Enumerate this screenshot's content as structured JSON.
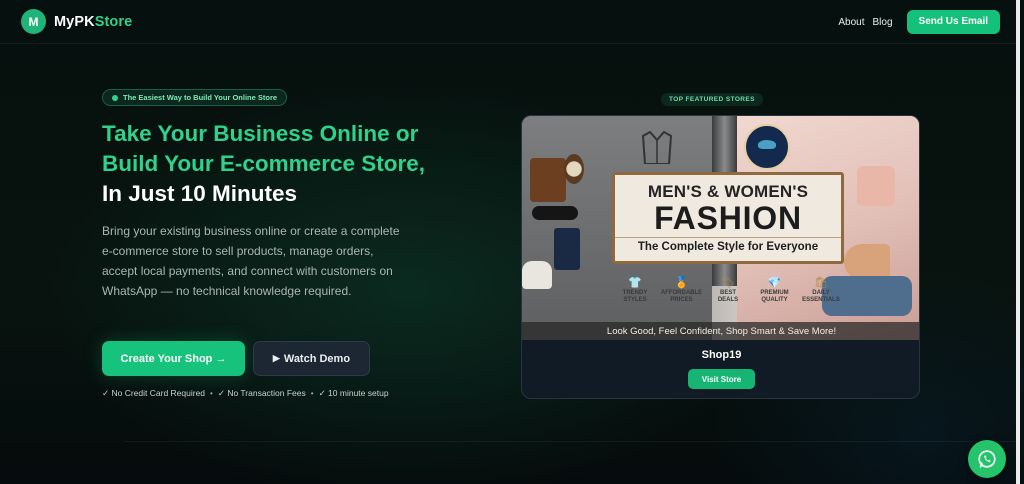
{
  "header": {
    "logo_letter": "M",
    "logo_text_a": "MyPK",
    "logo_text_b": "Store",
    "nav": [
      {
        "label": "About"
      },
      {
        "label": "Blog"
      }
    ],
    "cta_label": "Send Us Email"
  },
  "hero": {
    "pill": "The Easiest Way to Build Your Online Store",
    "headline_green_1": "Take Your Business Online or",
    "headline_green_2": "Build Your E-commerce Store,",
    "headline_white": "In Just 10 Minutes",
    "description": "Bring your existing business online or create a complete e-commerce store to sell products, manage orders, accept local payments, and connect with customers on WhatsApp — no technical knowledge required.",
    "primary_cta": "Create Your Shop →",
    "secondary_cta_icon": "▶",
    "secondary_cta": "Watch Demo",
    "perks": [
      "✓ No Credit Card Required",
      "✓ No Transaction Fees",
      "✓ 10 minute setup"
    ],
    "perk_separator": "•"
  },
  "featured": {
    "label": "TOP FEATURED STORES",
    "banner": {
      "line1": "MEN'S & WOMEN'S",
      "line2": "FASHION",
      "line3": "The Complete Style for Everyone",
      "features": [
        {
          "icon": "shirt-icon",
          "glyph": "👕",
          "label": "TRENDY\nSTYLES"
        },
        {
          "icon": "medal-icon",
          "glyph": "🏅",
          "label": "AFFORDABLE\nPRICES"
        },
        {
          "icon": "tag-icon",
          "glyph": "🏷",
          "label": "BEST\nDEALS"
        },
        {
          "icon": "diamond-icon",
          "glyph": "💎",
          "label": "PREMIUM\nQUALITY"
        },
        {
          "icon": "bag-icon",
          "glyph": "🛍",
          "label": "DAILY\nESSENTIALS"
        }
      ],
      "tagline": "Look Good, Feel Confident, Shop Smart & Save More!"
    },
    "store_name": "Shop19",
    "visit_label": "Visit Store"
  },
  "colors": {
    "accent": "#16c27c",
    "background": "#07110f"
  }
}
